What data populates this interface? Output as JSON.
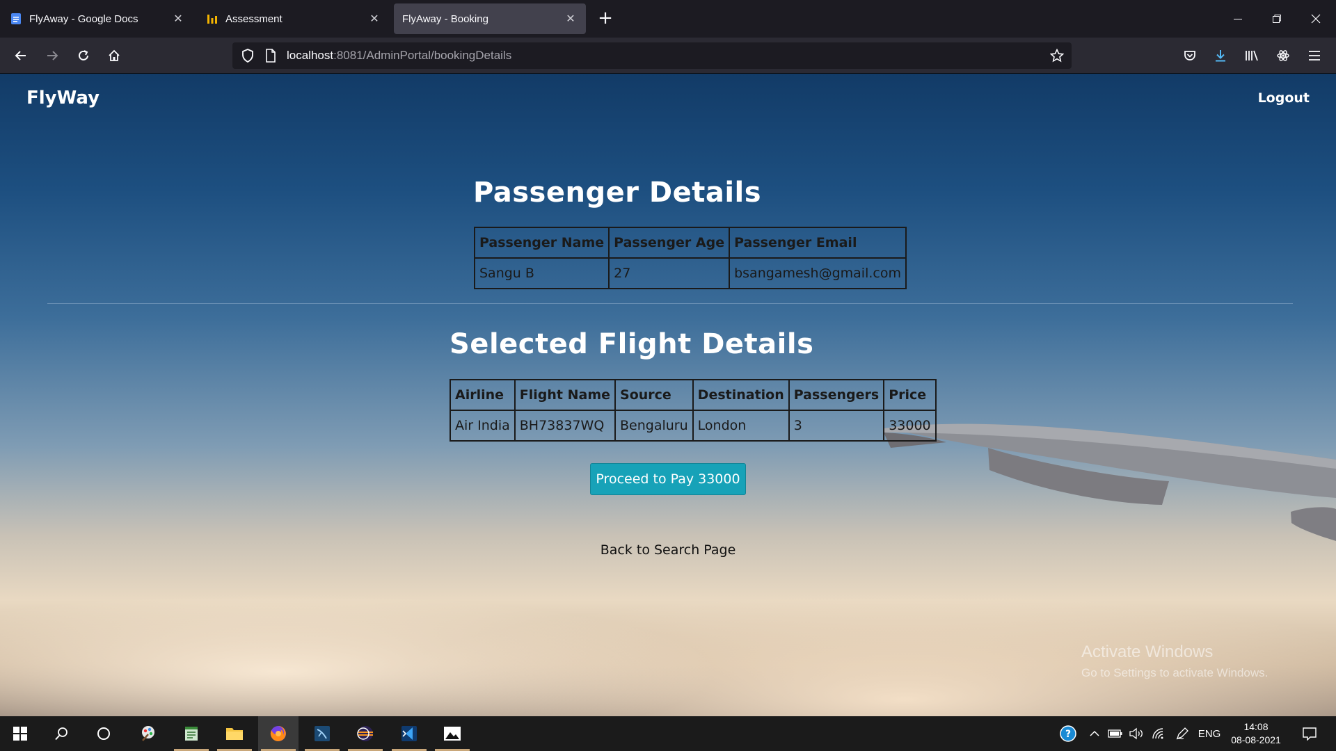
{
  "browser": {
    "tabs": [
      {
        "title": "FlyAway - Google Docs",
        "icon": "docs-icon",
        "active": false
      },
      {
        "title": "Assessment",
        "icon": "chart-icon",
        "active": false
      },
      {
        "title": "FlyAway - Booking",
        "icon": "none",
        "active": true
      }
    ],
    "url_host": "localhost",
    "url_rest": ":8081/AdminPortal/bookingDetails"
  },
  "page": {
    "brand": "FlyWay",
    "logout": "Logout",
    "passenger_heading": "Passenger Details",
    "passenger_table": {
      "headers": [
        "Passenger Name",
        "Passenger Age",
        "Passenger Email"
      ],
      "rows": [
        [
          "Sangu B",
          "27",
          "bsangamesh@gmail.com"
        ]
      ]
    },
    "flight_heading": "Selected Flight Details",
    "flight_table": {
      "headers": [
        "Airline",
        "Flight Name",
        "Source",
        "Destination",
        "Passengers",
        "Price"
      ],
      "rows": [
        [
          "Air India",
          "BH73837WQ",
          "Bengaluru",
          "London",
          "3",
          "33000"
        ]
      ]
    },
    "pay_button": "Proceed to Pay 33000",
    "back_link": "Back to Search Page"
  },
  "watermark": {
    "line1": "Activate Windows",
    "line2": "Go to Settings to activate Windows."
  },
  "taskbar": {
    "language": "ENG",
    "time": "14:08",
    "date": "08-08-2021"
  },
  "colors": {
    "pay_button": "#17a2b8",
    "tab_active": "#42414d",
    "toolbar": "#2b2a33"
  }
}
